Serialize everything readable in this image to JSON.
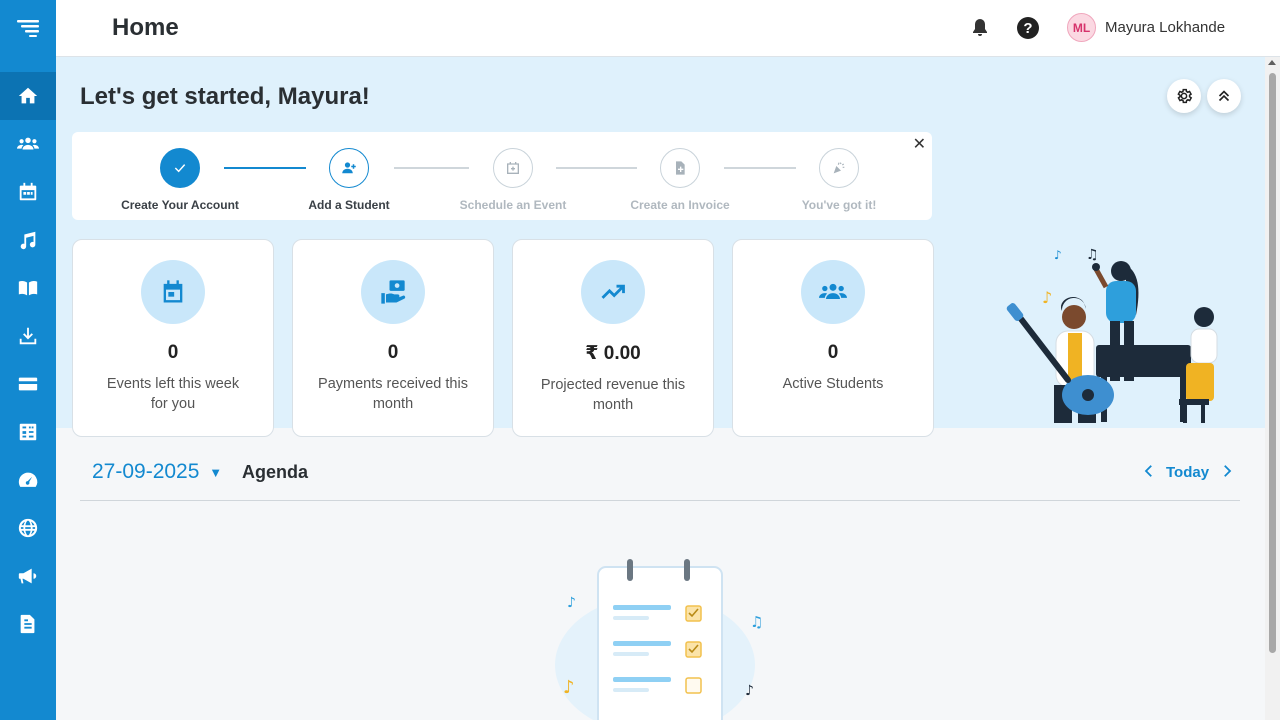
{
  "header": {
    "title": "Home",
    "user": {
      "initials": "ML",
      "name": "Mayura Lokhande"
    }
  },
  "sidebar": {
    "items": [
      {
        "icon": "home-icon",
        "active": true
      },
      {
        "icon": "students-icon"
      },
      {
        "icon": "calendar-icon"
      },
      {
        "icon": "music-note-icon"
      },
      {
        "icon": "book-open-icon"
      },
      {
        "icon": "download-icon"
      },
      {
        "icon": "credit-card-icon"
      },
      {
        "icon": "calculator-icon"
      },
      {
        "icon": "dashboard-gauge-icon"
      },
      {
        "icon": "globe-icon"
      },
      {
        "icon": "megaphone-icon"
      },
      {
        "icon": "document-icon"
      }
    ]
  },
  "greeting": "Let's get started, Mayura!",
  "onboarding": {
    "steps": [
      {
        "label": "Create Your Account",
        "state": "done"
      },
      {
        "label": "Add a Student",
        "state": "current"
      },
      {
        "label": "Schedule an Event",
        "state": "pending"
      },
      {
        "label": "Create an Invoice",
        "state": "pending"
      },
      {
        "label": "You've got it!",
        "state": "pending"
      }
    ],
    "close": "✕"
  },
  "stats": [
    {
      "value": "0",
      "label": "Events left this week for you",
      "icon": "calendar-icon"
    },
    {
      "value": "0",
      "label": "Payments received this month",
      "icon": "cash-hand-icon"
    },
    {
      "value": "₹ 0.00",
      "label": "Projected revenue this month",
      "icon": "trend-up-icon"
    },
    {
      "value": "0",
      "label": "Active Students",
      "icon": "students-icon"
    }
  ],
  "agenda": {
    "date": "27-09-2025",
    "label": "Agenda",
    "today": "Today"
  },
  "colors": {
    "primary": "#1389d0",
    "hero_bg": "#dff1fc"
  }
}
